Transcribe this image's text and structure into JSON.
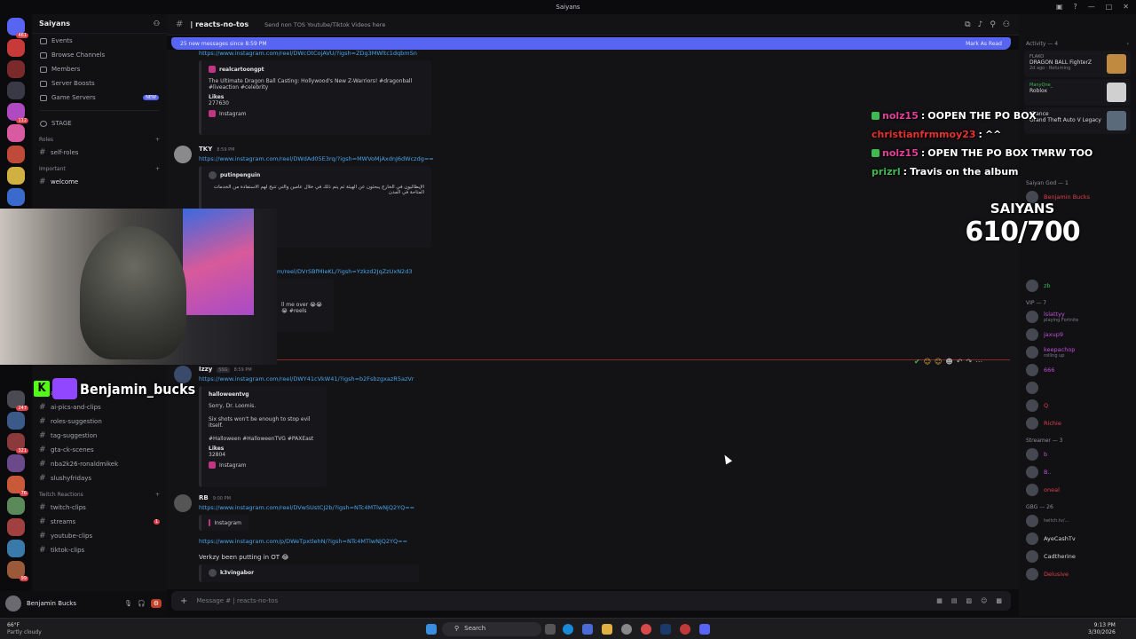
{
  "window": {
    "title": "Saiyans"
  },
  "server": {
    "name": "Saiyans"
  },
  "nav": [
    {
      "label": "Events",
      "icon": "calendar-icon"
    },
    {
      "label": "Browse Channels",
      "icon": "list-icon"
    },
    {
      "label": "Members",
      "icon": "members-icon"
    },
    {
      "label": "Server Boosts",
      "icon": "boost-icon"
    },
    {
      "label": "Game Servers",
      "icon": "game-icon",
      "badge": "NEW"
    }
  ],
  "stage": "STAGE",
  "categories": {
    "roles": "Roles",
    "important": "Important",
    "twitch": "Twitch Reactions"
  },
  "channels_top": [
    {
      "name": "self-roles"
    },
    {
      "name": "welcome"
    }
  ],
  "channels_mid": [
    {
      "name": "art"
    },
    {
      "name": "ai-pics-and-clips"
    },
    {
      "name": "roles-suggestion"
    },
    {
      "name": "tag-suggestion"
    },
    {
      "name": "gta-ck-scenes"
    },
    {
      "name": "nba2k26-ronaldmikek"
    },
    {
      "name": "slushyfridays"
    }
  ],
  "channels_twitch": [
    {
      "name": "twitch-clips"
    },
    {
      "name": "streams",
      "badge": "1"
    },
    {
      "name": "youtube-clips"
    },
    {
      "name": "tiktok-clips"
    }
  ],
  "server_badges": [
    "461",
    "247",
    "321",
    "76",
    "112",
    "99"
  ],
  "user": {
    "name": "Benjamin Bucks"
  },
  "header": {
    "channel": "reacts-no-tos",
    "topic": "Send non TOS Youtube/Tiktok Videos here",
    "search_placeholder": "Search Saiyans"
  },
  "newbar": {
    "text": "25 new messages since 8:59 PM",
    "action": "Mark As Read"
  },
  "messages": [
    {
      "link": "https://www.instagram.com/reel/DWcOtCojAVU/?igsh=ZDg3MWltc1dqbmSn",
      "embed_author": "realcartoongpt",
      "embed_text": "The Ultimate Dragon Ball Casting: Hollywood's New Z-Warriors! #dragonball #liveaction #celebrity",
      "likes_label": "Likes",
      "likes": "277630",
      "footer": "Instagram"
    },
    {
      "user": "TKY",
      "time": "8:59 PM",
      "link": "https://www.instagram.com/reel/DWdAd05E3rq/?igsh=MWVoMjAxdnJ6dWczdg==",
      "embed_author": "putinpenguin",
      "embed_text": "الإيطاليون في الخارج يبحثون عن الهيئة ثم يتم ذلك في خلال عامين والتي تتيح لهم الاستفادة من الخدمات المتاحة في المدن"
    },
    {
      "link": "m/reel/DVrSBfMIeKL/?igsh=Yzkzd2JqZzUxN2d3",
      "embed_text": "ll me over 😭😭😭 #reels"
    },
    {
      "user": "Izzy",
      "tag": "SSG",
      "time": "8:59 PM",
      "link": "https://www.instagram.com/reel/DWY41cVkW41/?igsh=b2FsbzgxazR5azVr",
      "embed_author": "halloweentvg",
      "embed_lines": [
        "Sorry, Dr. Loomis.",
        "Six shots won't be enough to stop evil itself.",
        "#Halloween #HalloweenTVG #PAXEast"
      ],
      "likes_label": "Likes",
      "likes": "32804",
      "footer": "Instagram"
    },
    {
      "user": "RB",
      "time": "9:00 PM",
      "link": "https://www.instagram.com/reel/DVwSUstCJ2b/?igsh=NTc4MTlwNjQ2YQ==",
      "footer": "Instagram",
      "link2": "https://www.instagram.com/p/DWeTpxtlehN/?igsh=NTc4MTlwNjQ2YQ==",
      "text": "Verkzy been putting in OT 😂",
      "embed_author": "k3vingabor"
    }
  ],
  "composer": {
    "placeholder": "Message # | reacts-no-tos"
  },
  "activity": {
    "header": "Activity — 4",
    "items": [
      {
        "user": "FLAKO",
        "game": "DRAGON BALL FighterZ",
        "meta": "2d ago · Returning"
      },
      {
        "user": "ManyQne_",
        "game": "Roblox",
        "meta": ""
      },
      {
        "user": "chance",
        "game": "Grand Theft Auto V Legacy",
        "meta": ""
      }
    ]
  },
  "member_groups": [
    {
      "title": "Saiyan God — 1",
      "members": [
        {
          "name": "Benjamin Bucks",
          "color": "#e0404a"
        }
      ]
    },
    {
      "title": "— 3",
      "members": [
        {
          "name": "ManyQne_",
          "color": "#3fb950"
        },
        {
          "name": "",
          "color": "#b5bac1"
        },
        {
          "name": "zb",
          "color": "#3fb950"
        }
      ]
    },
    {
      "title": "VIP — 7",
      "members": [
        {
          "name": "lslattyy",
          "color": "#c050d8",
          "sub": "playing Fortnite"
        },
        {
          "name": "jaxup9",
          "color": "#c050d8"
        },
        {
          "name": "keepachop",
          "color": "#c050d8",
          "sub": "rolling up"
        },
        {
          "name": "666",
          "color": "#c050d8"
        },
        {
          "name": "",
          "color": "#c050d8"
        },
        {
          "name": "Q",
          "color": "#e0404a"
        },
        {
          "name": "Richie",
          "color": "#e0404a"
        }
      ]
    },
    {
      "title": "Streamer — 3",
      "members": [
        {
          "name": "b",
          "color": "#c050d8"
        },
        {
          "name": "B..",
          "color": "#c050d8"
        },
        {
          "name": "oneal",
          "color": "#e0404a"
        }
      ]
    },
    {
      "title": "GBG — 26",
      "members": [
        {
          "name": "",
          "color": "#b5bac1",
          "sub": "twitch.tv/..."
        },
        {
          "name": "AyeCashTv",
          "color": "#d8d8d8"
        },
        {
          "name": "Cadtherine",
          "color": "#d8d8d8"
        },
        {
          "name": "Delusive",
          "color": "#e0404a"
        },
        {
          "name": "",
          "color": "#b5bac1"
        }
      ]
    }
  ],
  "overlay": {
    "chat": [
      {
        "user": "nolz15",
        "color": "#e0409a",
        "text": "OOPEN THE PO BOX"
      },
      {
        "user": "christianfrmmoy23",
        "color": "#e83030",
        "text": "^^"
      },
      {
        "user": "nolz15",
        "color": "#e0409a",
        "text": "OPEN THE PO BOX TMRW TOO"
      },
      {
        "user": "prizrl",
        "color": "#3fb950",
        "text": "Travis on the album"
      }
    ],
    "goal_label": "SAIYANS",
    "goal_count": "610/700",
    "streamer_name": "Benjamin_bucks"
  },
  "taskbar": {
    "weather_temp": "66°F",
    "weather_desc": "Partly cloudy",
    "search": "Search",
    "time": "9:13 PM",
    "date": "3/30/2026"
  }
}
